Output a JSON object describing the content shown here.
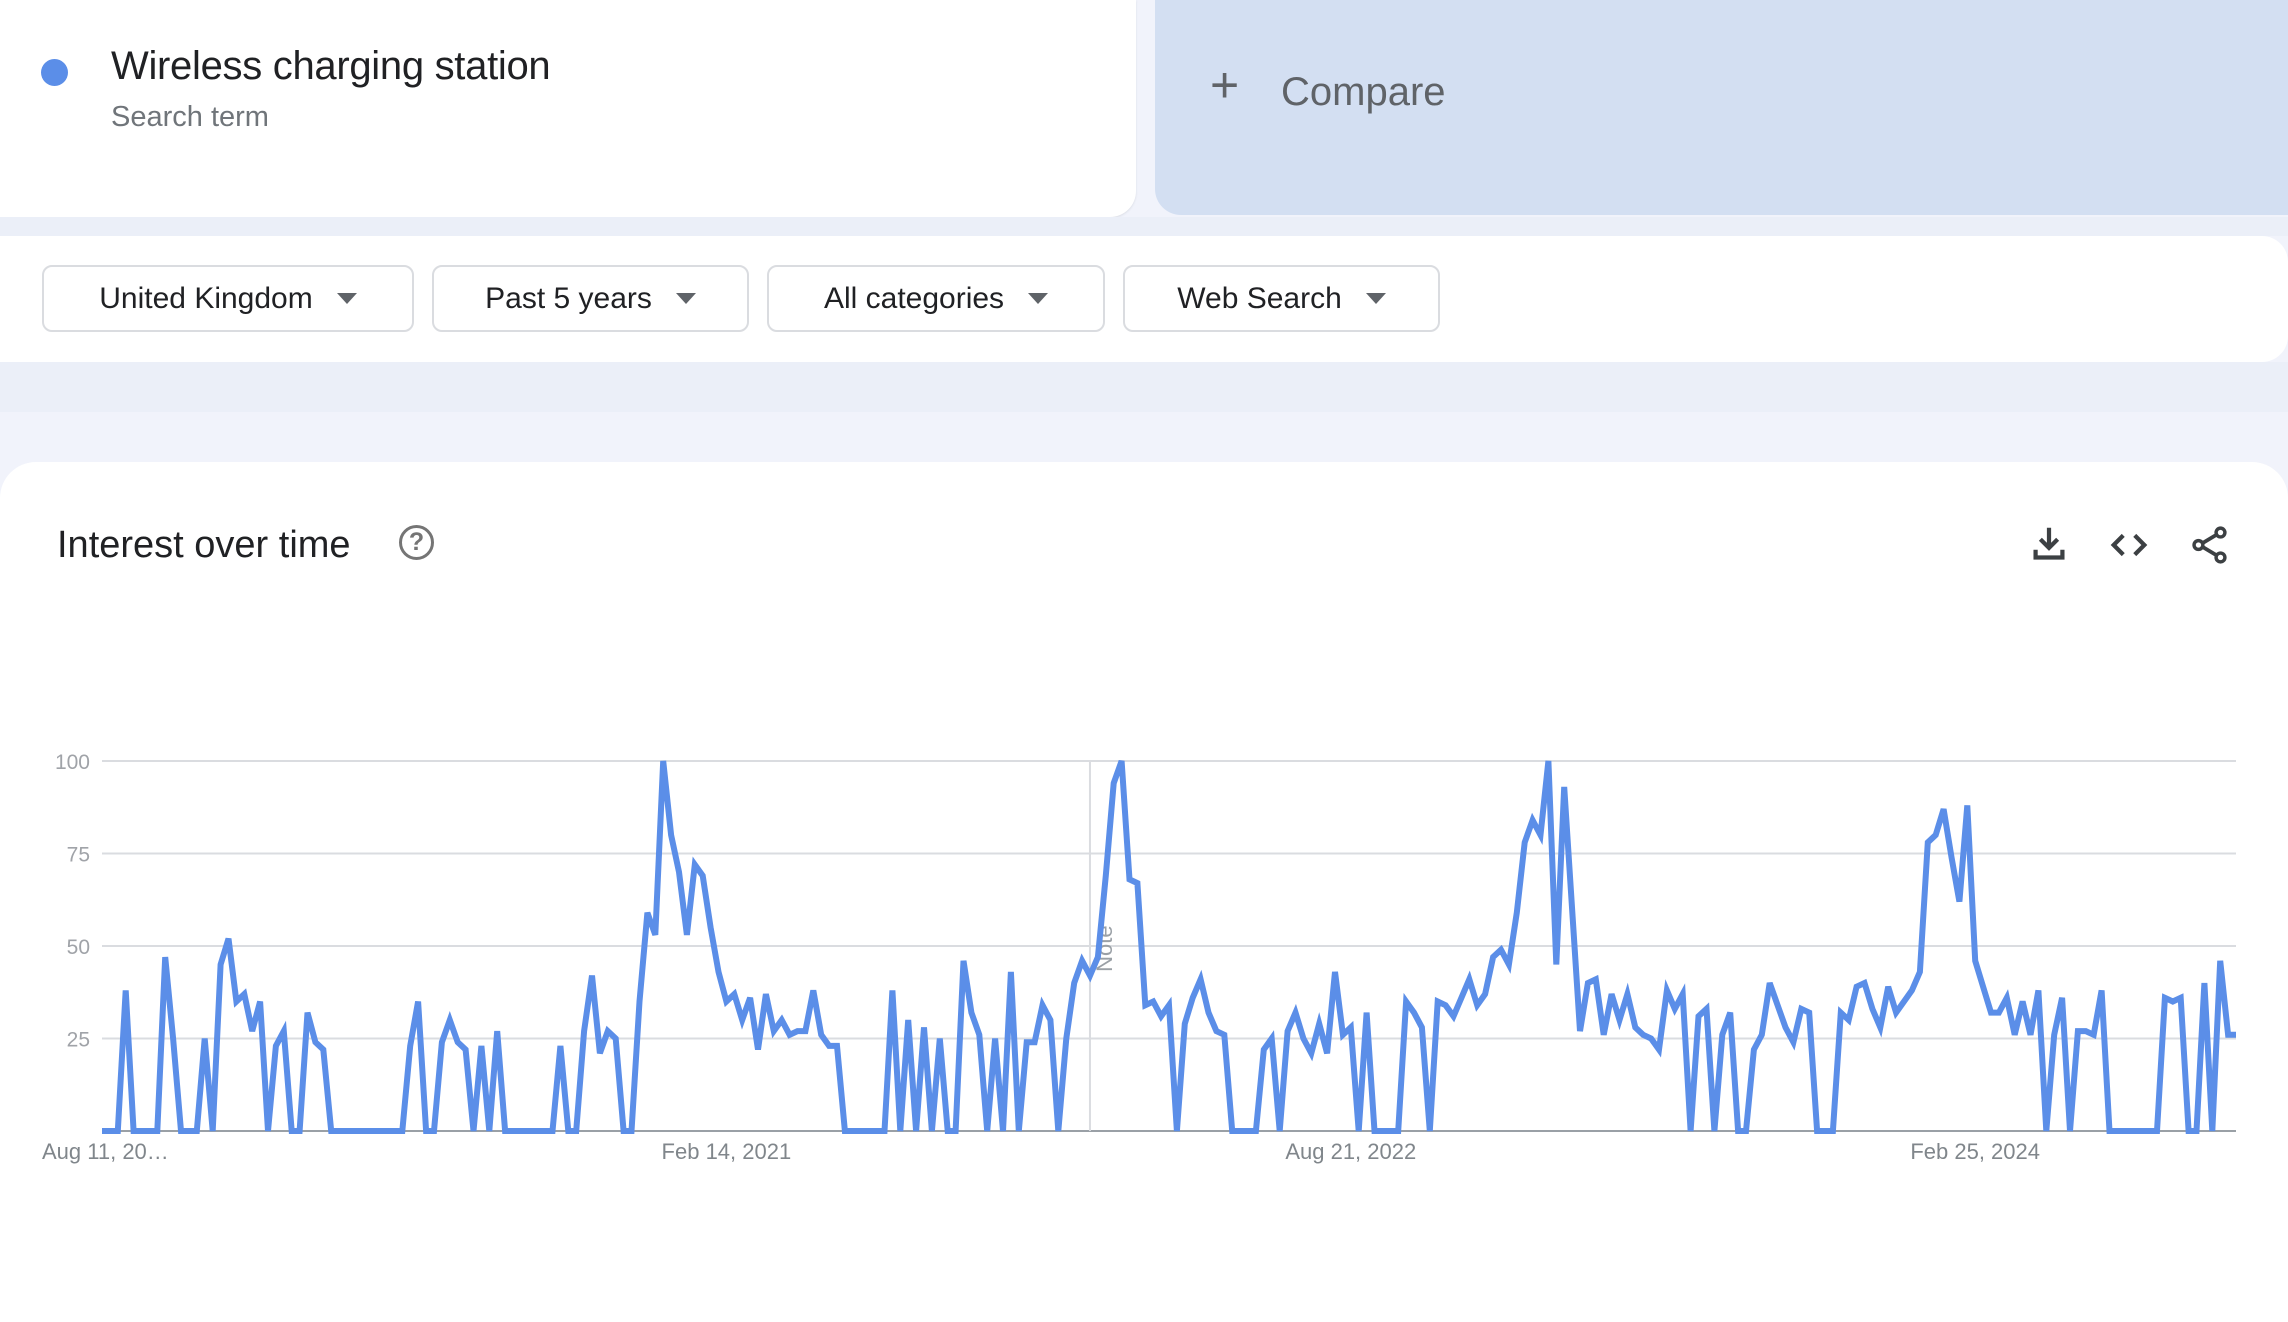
{
  "search_term": {
    "title": "Wireless charging station",
    "subtitle": "Search term",
    "color": "#5b8ee8"
  },
  "compare": {
    "icon": "plus-icon",
    "plus": "+",
    "label": "Compare"
  },
  "filters": [
    {
      "label": "United Kingdom"
    },
    {
      "label": "Past 5 years"
    },
    {
      "label": "All categories"
    },
    {
      "label": "Web Search"
    }
  ],
  "panel": {
    "title": "Interest over time",
    "help": "?",
    "actions": [
      "download-icon",
      "embed-code-icon",
      "share-icon"
    ]
  },
  "chart_data": {
    "type": "line",
    "title": "Interest over time",
    "xlabel": "",
    "ylabel": "",
    "ylim": [
      0,
      100
    ],
    "yticks": [
      25,
      50,
      75,
      100
    ],
    "xtick_labels": [
      "Aug 11, 20…",
      "Feb 14, 2021",
      "Aug 21, 2022",
      "Feb 25, 2024"
    ],
    "xtick_indices": [
      0,
      79,
      158,
      237
    ],
    "annotation": {
      "label": "Note",
      "index": 125
    },
    "grid": true,
    "legend": "none",
    "series": [
      {
        "name": "Wireless charging station",
        "color": "#5b8ee8",
        "values": [
          0,
          0,
          0,
          38,
          0,
          0,
          0,
          0,
          47,
          25,
          0,
          0,
          0,
          25,
          0,
          45,
          52,
          35,
          37,
          27,
          35,
          0,
          23,
          27,
          0,
          0,
          32,
          24,
          22,
          0,
          0,
          0,
          0,
          0,
          0,
          0,
          0,
          0,
          0,
          23,
          35,
          0,
          0,
          24,
          30,
          24,
          22,
          0,
          23,
          0,
          27,
          0,
          0,
          0,
          0,
          0,
          0,
          0,
          23,
          0,
          0,
          27,
          42,
          21,
          27,
          25,
          0,
          0,
          35,
          59,
          53,
          100,
          80,
          70,
          53,
          72,
          69,
          55,
          43,
          35,
          37,
          30,
          36,
          22,
          37,
          27,
          30,
          26,
          27,
          27,
          38,
          26,
          23,
          23,
          0,
          0,
          0,
          0,
          0,
          0,
          38,
          0,
          30,
          0,
          28,
          0,
          25,
          0,
          0,
          46,
          32,
          26,
          0,
          25,
          0,
          43,
          0,
          24,
          24,
          34,
          30,
          0,
          25,
          40,
          46,
          42,
          47,
          69,
          94,
          100,
          68,
          67,
          34,
          35,
          31,
          34,
          0,
          29,
          36,
          41,
          32,
          27,
          26,
          0,
          0,
          0,
          0,
          22,
          25,
          0,
          27,
          32,
          25,
          21,
          29,
          21,
          43,
          26,
          28,
          0,
          32,
          0,
          0,
          0,
          0,
          35,
          32,
          28,
          0,
          35,
          34,
          31,
          36,
          41,
          34,
          37,
          47,
          49,
          45,
          59,
          78,
          84,
          80,
          100,
          45,
          93,
          60,
          27,
          40,
          41,
          26,
          37,
          30,
          37,
          28,
          26,
          25,
          22,
          38,
          33,
          37,
          0,
          31,
          33,
          0,
          26,
          32,
          0,
          0,
          22,
          26,
          40,
          34,
          28,
          24,
          33,
          32,
          0,
          0,
          0,
          32,
          30,
          39,
          40,
          33,
          28,
          39,
          32,
          35,
          38,
          43,
          78,
          80,
          87,
          74,
          62,
          88,
          46,
          39,
          32,
          32,
          36,
          26,
          35,
          26,
          38,
          0,
          26,
          36,
          0,
          27,
          27,
          26,
          38,
          0,
          0,
          0,
          0,
          0,
          0,
          0,
          36,
          35,
          36,
          0,
          0,
          40,
          0,
          46,
          26,
          26
        ]
      }
    ]
  }
}
